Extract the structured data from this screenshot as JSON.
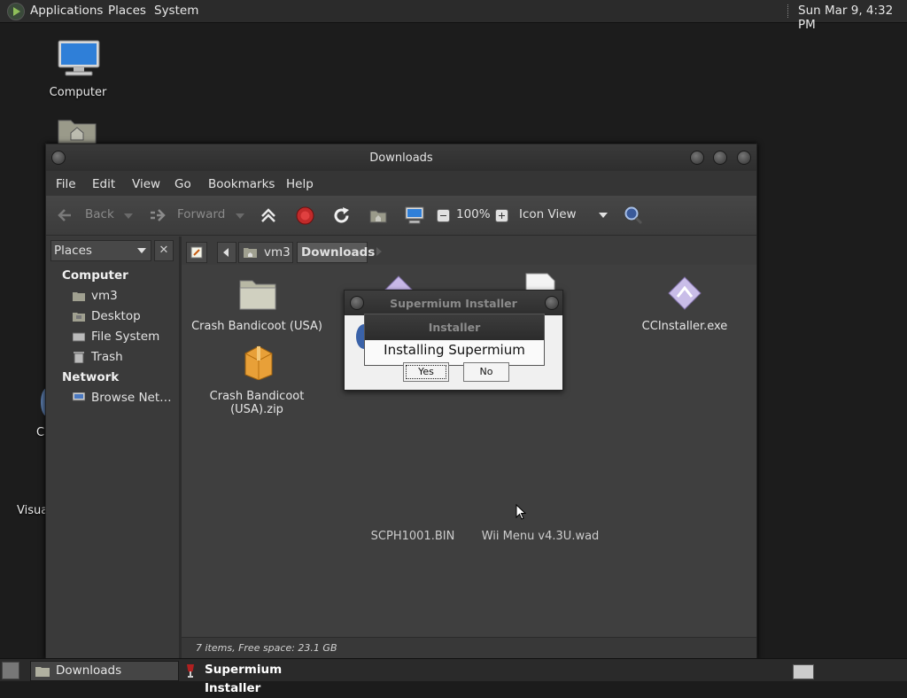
{
  "top_panel": {
    "menus": [
      "Applications",
      "Places",
      "System"
    ],
    "clock": "Sun Mar 9,  4:32 PM"
  },
  "desktop": {
    "icons": [
      {
        "label": "Computer",
        "icon": "computer-icon"
      },
      {
        "label": "",
        "icon": "home-folder-icon"
      },
      {
        "label": "C",
        "icon": "disc-icon"
      },
      {
        "label": "Visua",
        "icon": "app-icon"
      }
    ]
  },
  "window": {
    "title": "Downloads",
    "menu": [
      "File",
      "Edit",
      "View",
      "Go",
      "Bookmarks",
      "Help"
    ],
    "toolbar": {
      "back": "Back",
      "forward": "Forward",
      "zoom": "100%",
      "view_mode": "Icon View"
    },
    "sidebar": {
      "selector": "Places",
      "close": "✕",
      "sections": [
        {
          "heading": "Computer",
          "items": [
            "vm3",
            "Desktop",
            "File System",
            "Trash"
          ]
        },
        {
          "heading": "Network",
          "items": [
            "Browse Net…"
          ]
        }
      ]
    },
    "path": {
      "crumbs": [
        "vm3",
        "Downloads"
      ]
    },
    "files": [
      {
        "name": "Crash Bandicoot (USA)",
        "icon": "folder-icon"
      },
      {
        "name": "CCInstaller.exe",
        "icon": "exe-icon"
      },
      {
        "name": "Crash Bandicoot (USA).zip",
        "icon": "archive-icon"
      },
      {
        "name": "SCPH1001.BIN",
        "icon": "bin-file-icon"
      },
      {
        "name": "Wii Menu v4.3U.wad",
        "icon": "wad-file-icon"
      }
    ],
    "status": "7 items, Free space: 23.1 GB"
  },
  "dialog": {
    "title": "Supermium Installer",
    "inner_title": "Installer",
    "message": "Installing Supermium",
    "yes": "Yes",
    "no": "No"
  },
  "bottom_panel": {
    "tasks": [
      "Downloads",
      "Supermium Installer"
    ]
  },
  "colors": {
    "panel": "#2b2b2b",
    "window": "#3c3c3c",
    "dialog": "#f0f0f0"
  }
}
